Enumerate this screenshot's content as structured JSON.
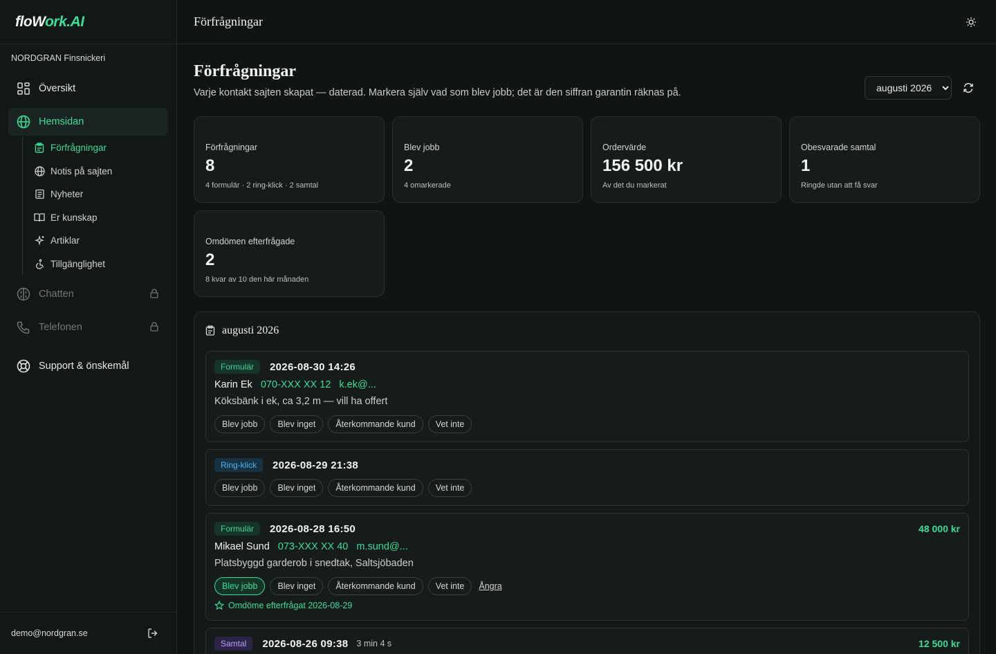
{
  "brand": {
    "logo_prefix": "floW",
    "logo_suffix": "ork.AI",
    "accent": "#3ddc97"
  },
  "sidebar": {
    "org": "NORDGRAN Finsnickeri",
    "overview": "Översikt",
    "website": "Hemsidan",
    "sub_items": [
      "Förfrågningar",
      "Notis på sajten",
      "Nyheter",
      "Er kunskap",
      "Artiklar",
      "Tillgänglighet"
    ],
    "chat": "Chatten",
    "phone": "Telefonen",
    "support": "Support & önskemål",
    "user_email": "demo@nordgran.se"
  },
  "header": {
    "title": "Förfrågningar"
  },
  "page": {
    "title": "Förfrågningar",
    "subtitle": "Varje kontakt sajten skapat — daterad. Markera själv vad som blev jobb; det är den siffran garantin räknas på.",
    "month_selected": "augusti 2026"
  },
  "stats": [
    {
      "label": "Förfrågningar",
      "value": "8",
      "note": "4 formulär · 2 ring-klick · 2 samtal"
    },
    {
      "label": "Blev jobb",
      "value": "2",
      "note": "4 omarkerade"
    },
    {
      "label": "Ordervärde",
      "value": "156 500 kr",
      "note": "Av det du markerat"
    },
    {
      "label": "Obesvarade samtal",
      "value": "1",
      "note": "Ringde utan att få svar"
    },
    {
      "label": "Omdömen efterfrågade",
      "value": "2",
      "note": "8 kvar av 10 den här månaden"
    }
  ],
  "list": {
    "heading": "augusti 2026",
    "actions": [
      "Blev jobb",
      "Blev inget",
      "Återkommande kund",
      "Vet inte"
    ],
    "undo": "Ångra",
    "entries": [
      {
        "type": "Formulär",
        "datetime": "2026-08-30 14:26",
        "name": "Karin Ek",
        "phone": "070-XXX XX 12",
        "email": "k.ek@...",
        "message": "Köksbänk i ek, ca 3,2 m — vill ha offert"
      },
      {
        "type": "Ring-klick",
        "datetime": "2026-08-29 21:38"
      },
      {
        "type": "Formulär",
        "datetime": "2026-08-28 16:50",
        "amount": "48 000 kr",
        "name": "Mikael Sund",
        "phone": "073-XXX XX 40",
        "email": "m.sund@...",
        "message": "Platsbyggd garderob i snedtak, Saltsjöbaden",
        "review": "Omdöme efterfrågat 2026-08-29"
      },
      {
        "type": "Samtal",
        "datetime": "2026-08-26 09:38",
        "duration": "3 min 4 s",
        "amount": "12 500 kr"
      }
    ]
  }
}
